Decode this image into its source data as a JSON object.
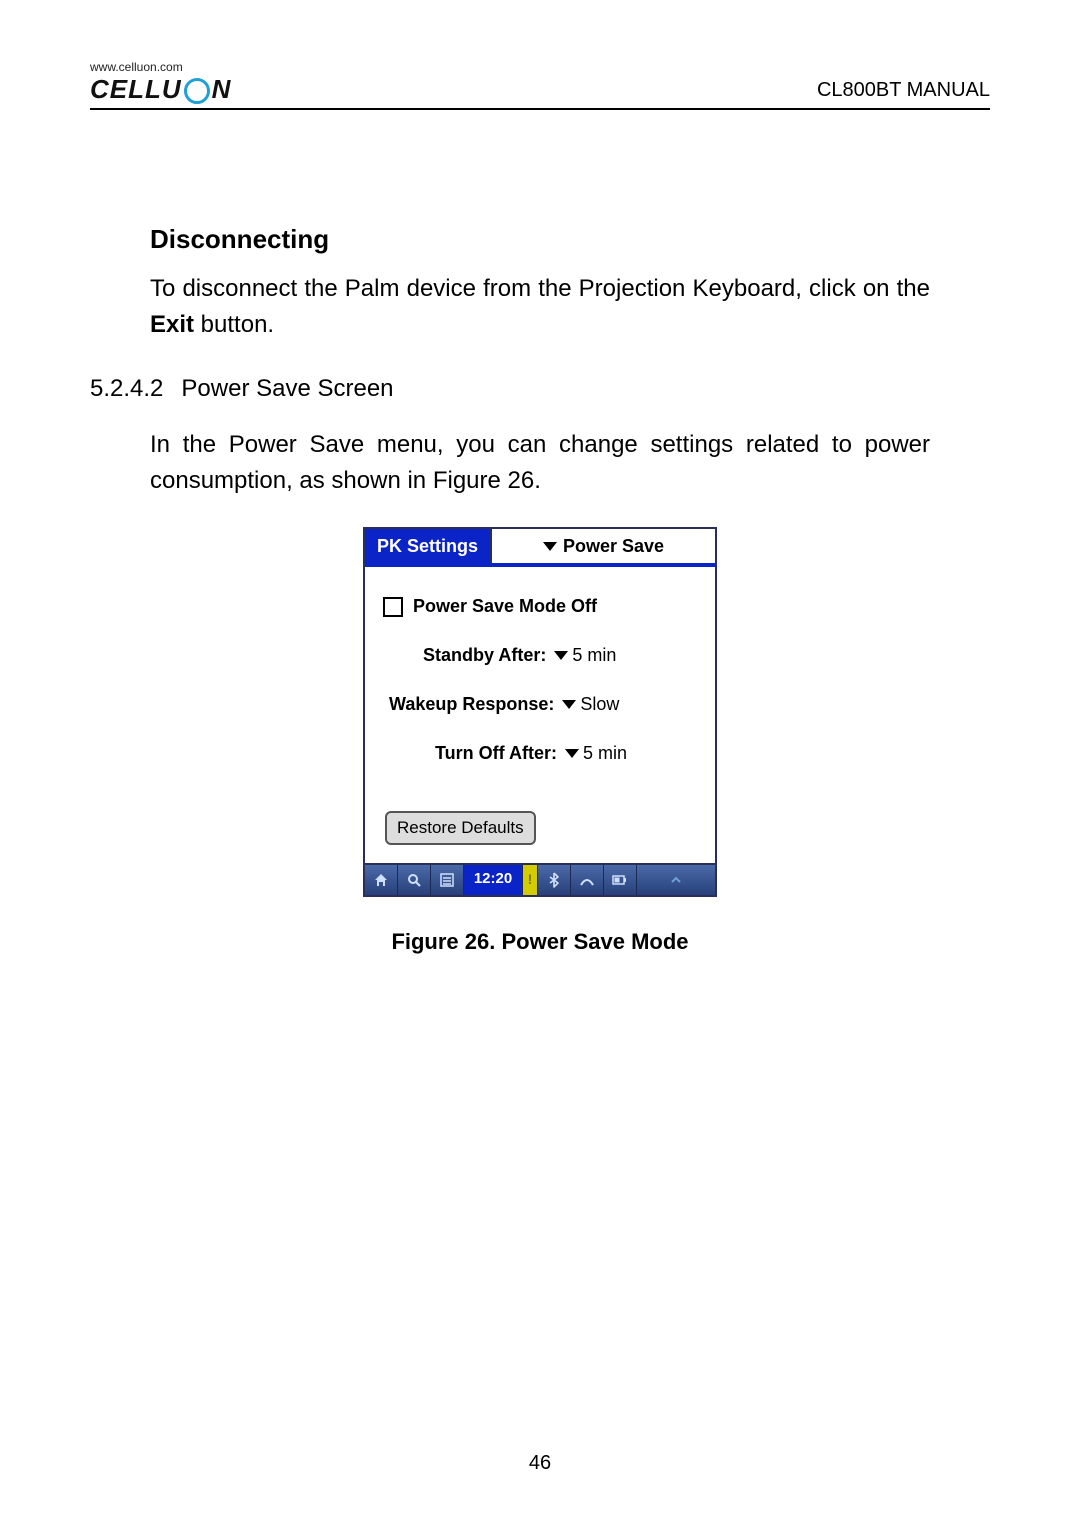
{
  "header": {
    "url": "www.celluon.com",
    "logo_left": "CELLU",
    "logo_right": "N",
    "doc_title": "CL800BT MANUAL"
  },
  "body": {
    "h_disconnecting": "Disconnecting",
    "p_disconnect_a": "To disconnect the Palm device from the Projection Keyboard, click on the ",
    "p_disconnect_bold": "Exit",
    "p_disconnect_b": " button.",
    "sec_num": "5.2.4.2",
    "sec_title": "Power Save Screen",
    "p_powersave": "In the Power Save menu, you can change settings related to power consumption, as shown in Figure 26."
  },
  "palm": {
    "title_left": "PK Settings",
    "title_right": "Power Save",
    "row_mode": "Power Save Mode Off",
    "standby_label": "Standby After:",
    "standby_val": "5 min",
    "wakeup_label": "Wakeup Response:",
    "wakeup_val": "Slow",
    "turnoff_label": "Turn Off After:",
    "turnoff_val": "5 min",
    "restore": "Restore Defaults",
    "clock": "12:20"
  },
  "caption": "Figure 26. Power Save Mode",
  "page_number": "46"
}
